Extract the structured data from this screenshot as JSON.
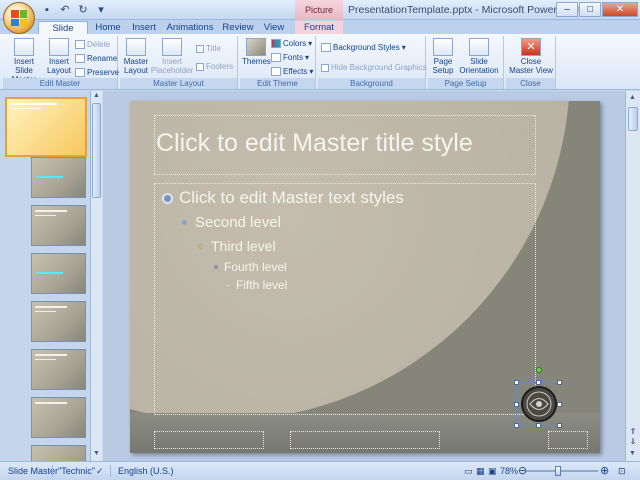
{
  "app": {
    "window_title": "PresentationTemplate.pptx - Microsoft PowerPoint",
    "context_tab_group": "Picture Tools"
  },
  "tabs": [
    "Slide Master",
    "Home",
    "Insert",
    "Animations",
    "Review",
    "View",
    "Format"
  ],
  "ribbon": {
    "edit_master": {
      "label": "Edit Master",
      "insert_slide_master": "Insert Slide Master",
      "insert_layout": "Insert Layout",
      "delete": "Delete",
      "rename": "Rename",
      "preserve": "Preserve"
    },
    "master_layout": {
      "label": "Master Layout",
      "master_layout_btn": "Master Layout",
      "insert_placeholder": "Insert Placeholder",
      "title": "Title",
      "footers": "Footers"
    },
    "edit_theme": {
      "label": "Edit Theme",
      "themes": "Themes",
      "colors": "Colors",
      "fonts": "Fonts",
      "effects": "Effects"
    },
    "background": {
      "label": "Background",
      "background_styles": "Background Styles",
      "hide_background_graphics": "Hide Background Graphics"
    },
    "page_setup": {
      "label": "Page Setup",
      "page_setup_btn": "Page Setup",
      "slide_orientation": "Slide Orientation"
    },
    "close": {
      "label": "Close",
      "close_master_view": "Close Master View"
    }
  },
  "slide": {
    "title": "Click to edit Master title style",
    "levels": [
      "Click to edit Master text styles",
      "Second level",
      "Third level",
      "Fourth level",
      "Fifth level"
    ]
  },
  "statusbar": {
    "view": "Slide Master",
    "theme": "\"Technic\"",
    "language": "English (U.S.)",
    "zoom": "78%"
  },
  "colors": {
    "slide_light": "#b7b1a2",
    "slide_dark": "#858579",
    "ribbon_text": "#15428b",
    "selected_thumb": "#f7c85e"
  }
}
